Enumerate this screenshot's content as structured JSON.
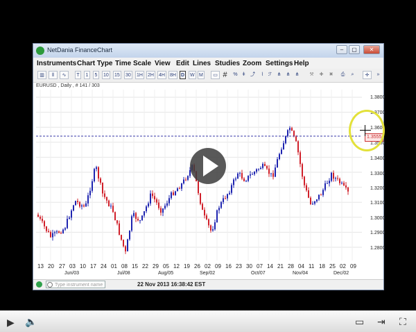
{
  "window": {
    "title": "NetDania FinanceChart",
    "buttons": [
      "‒",
      "▢",
      "✕"
    ]
  },
  "menu": [
    "Instruments",
    "Chart Type",
    "Time Scale",
    "View",
    "Edit",
    "Lines",
    "Studies",
    "Zoom",
    "Settings",
    "Help"
  ],
  "toolbar": {
    "timeframes": [
      "T",
      "1",
      "5",
      "10",
      "15",
      "30",
      "1H",
      "2H",
      "4H",
      "8H",
      "D",
      "W",
      "M"
    ]
  },
  "chart": {
    "info": "EURUSD , Daily , # 141 / 303",
    "price_tag": "1.3555",
    "y_ticks": [
      "1.3800",
      "1.3700",
      "1.3600",
      "1.3500",
      "1.3400",
      "1.3300",
      "1.3200",
      "1.3100",
      "1.3000",
      "1.2900",
      "1.2800"
    ],
    "x_ticks": [
      "13",
      "20",
      "27",
      "03",
      "10",
      "17",
      "24",
      "01",
      "08",
      "15",
      "22",
      "29",
      "05",
      "12",
      "19",
      "26",
      "02",
      "09",
      "16",
      "23",
      "30",
      "07",
      "14",
      "21",
      "28",
      "04",
      "11",
      "18",
      "25",
      "02",
      "09"
    ],
    "month_labels": [
      "Jun/03",
      "Jul/08",
      "Aug/05",
      "Sep/02",
      "Oct/07",
      "Nov/04",
      "Dec/02"
    ]
  },
  "status": {
    "search_placeholder": "Type instrument name",
    "timestamp": "22 Nov 2013 16:38:42 EST"
  },
  "player": {
    "progress": 0.01
  },
  "colors": {
    "up": "#1e24b0",
    "down": "#d0202a",
    "crosshair": "#3a3aa8"
  }
}
